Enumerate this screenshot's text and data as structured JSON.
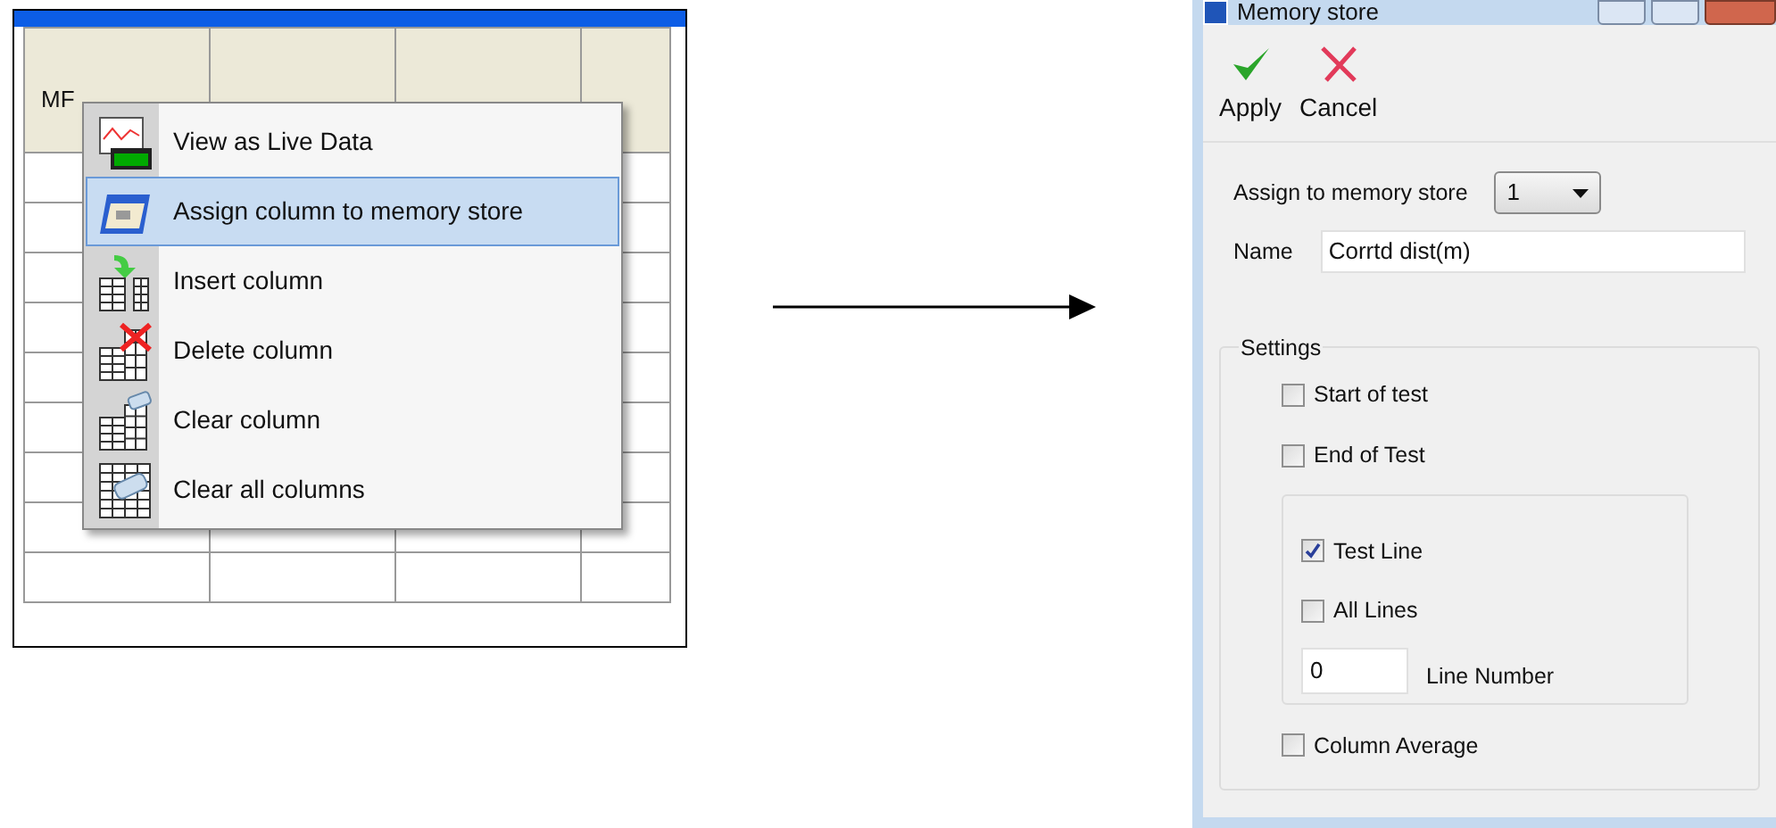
{
  "grid": {
    "first_header": "MF"
  },
  "context_menu": {
    "items": [
      {
        "label": "View as Live Data",
        "selected": false
      },
      {
        "label": "Assign column to memory store",
        "selected": true
      },
      {
        "label": "Insert column",
        "selected": false
      },
      {
        "label": "Delete column",
        "selected": false
      },
      {
        "label": "Clear column",
        "selected": false
      },
      {
        "label": "Clear all columns",
        "selected": false
      }
    ]
  },
  "dialog": {
    "title": "Memory store",
    "toolbar": [
      {
        "label": "Apply",
        "kind": "apply"
      },
      {
        "label": "Cancel",
        "kind": "cancel"
      }
    ],
    "memory_store": {
      "label": "Assign to memory store",
      "value": "1"
    },
    "name": {
      "label": "Name",
      "value": "Corrtd dist(m)"
    },
    "settings": {
      "title": "Settings",
      "options": [
        {
          "label": "Start of test",
          "checked": false
        },
        {
          "label": "End of Test",
          "checked": false
        }
      ],
      "line_group": {
        "options": [
          {
            "label": "Test Line",
            "checked": true
          },
          {
            "label": "All Lines",
            "checked": false
          }
        ],
        "line_number": {
          "value": "0",
          "label": "Line Number"
        }
      },
      "column_average": {
        "label": "Column Average",
        "checked": false
      }
    }
  }
}
